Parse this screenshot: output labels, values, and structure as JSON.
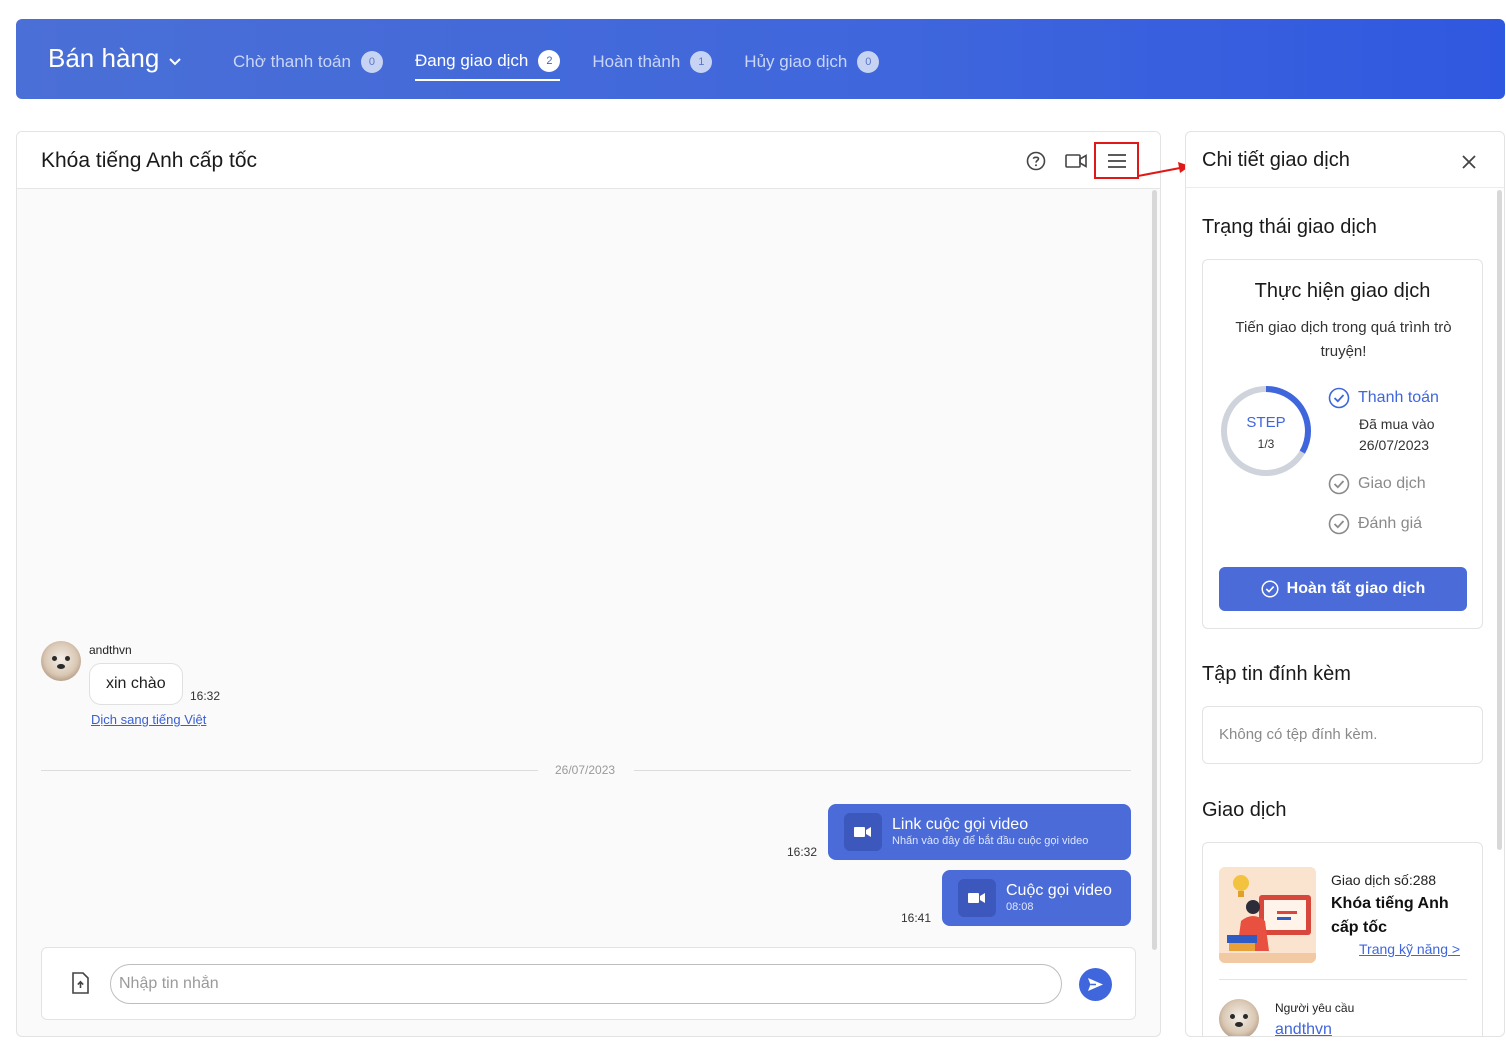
{
  "header": {
    "brand": "Bán hàng",
    "tabs": [
      {
        "label": "Chờ thanh toán",
        "count": "0"
      },
      {
        "label": "Đang giao dịch",
        "count": "2"
      },
      {
        "label": "Hoàn thành",
        "count": "1"
      },
      {
        "label": "Hủy giao dịch",
        "count": "0"
      }
    ]
  },
  "chat": {
    "title": "Khóa tiếng Anh cấp tốc",
    "incoming": {
      "sender": "andthvn",
      "text": "xin chào",
      "time": "16:32",
      "translate_link": "Dịch sang tiếng Việt"
    },
    "date_separator": "26/07/2023",
    "outgoing": [
      {
        "title": "Link cuộc gọi video",
        "subtitle": "Nhấn vào đây để bắt đầu cuộc gọi video",
        "time": "16:32"
      },
      {
        "title": "Cuộc gọi video",
        "subtitle": "08:08",
        "time": "16:41"
      }
    ],
    "composer": {
      "placeholder": "Nhập tin nhắn"
    }
  },
  "detail": {
    "title": "Chi tiết giao dịch",
    "status_section": "Trạng thái giao dịch",
    "status_card": {
      "title": "Thực hiện giao dịch",
      "subtitle": "Tiến giao dịch trong quá trình trò truyện!",
      "ring_label": "STEP",
      "ring_value": "1/3",
      "progress": 0.3333,
      "steps": [
        {
          "label": "Thanh toán",
          "state": "done",
          "note": "Đã mua vào 26/07/2023"
        },
        {
          "label": "Giao dịch",
          "state": "pending"
        },
        {
          "label": "Đánh giá",
          "state": "pending"
        }
      ],
      "finish_button": "Hoàn tất giao dịch"
    },
    "files_section": "Tập tin đính kèm",
    "no_files": "Không có tệp đính kèm.",
    "transaction_section": "Giao dịch",
    "transaction": {
      "number_label": "Giao dịch số:288",
      "name": "Khóa tiếng Anh cấp tốc",
      "link": "Trang kỹ năng >",
      "requester_label": "Người yêu cầu",
      "requester": "andthvn"
    }
  },
  "colors": {
    "primary": "#3f66dc",
    "bubble": "#4a6bd8",
    "highlight": "#e01818"
  }
}
